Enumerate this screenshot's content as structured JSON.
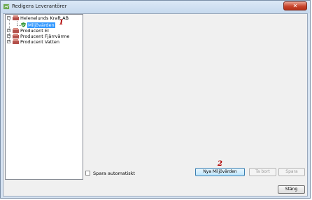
{
  "window": {
    "title": "Redigera Leverantörer",
    "close_glyph": "✕"
  },
  "tree": {
    "items": [
      {
        "label": "Helenelunds Kraft AB",
        "expander": "−"
      },
      {
        "label": "Miljövärden"
      },
      {
        "label": "Producent El",
        "expander": "+"
      },
      {
        "label": "Producent Fjärrvärme",
        "expander": "+"
      },
      {
        "label": "Producent Vatten",
        "expander": "+"
      }
    ]
  },
  "annotations": {
    "marker1": "1",
    "marker2": "2"
  },
  "footer": {
    "autosave_label": "Spara automatiskt",
    "new_button": "Nya Miljövärden",
    "delete_button": "Ta bort",
    "save_button": "Spara",
    "close_button": "Stäng"
  },
  "icons": {
    "title": "app-icon",
    "supplier": "supplier-icon",
    "env": "shield-check-icon"
  },
  "colors": {
    "selection": "#3399ff",
    "marker": "#b00000",
    "close": "#c8442c"
  }
}
